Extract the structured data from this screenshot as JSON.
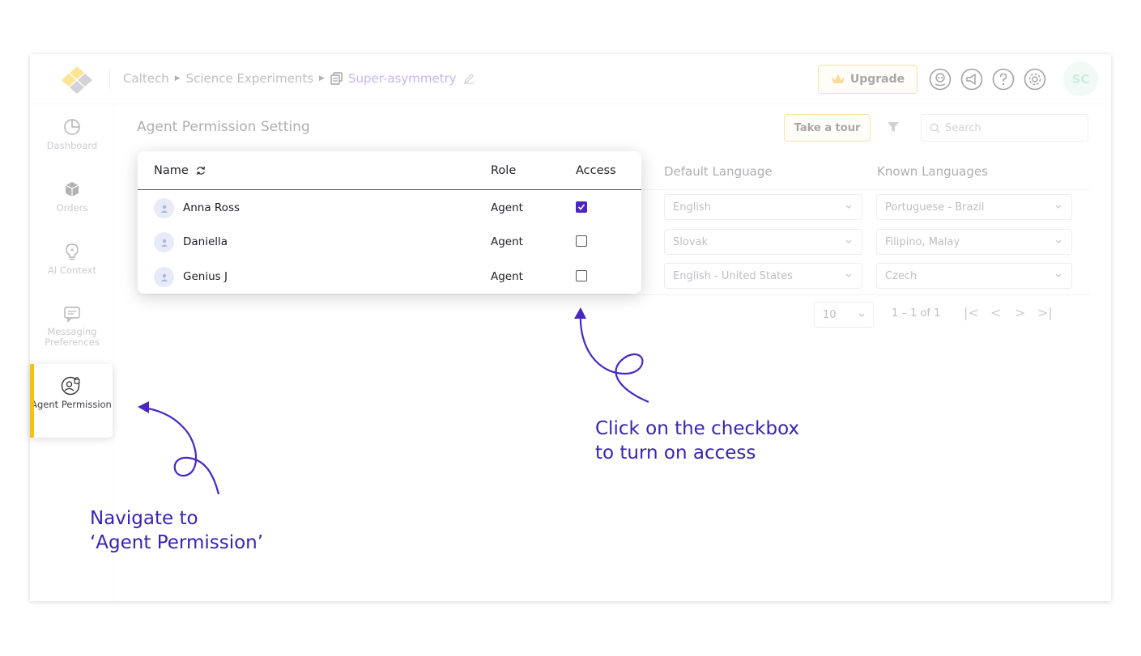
{
  "header": {
    "breadcrumb": [
      "Caltech",
      "Science Experiments",
      "Super-asymmetry"
    ],
    "upgrade_label": "Upgrade",
    "avatar_initials": "SC"
  },
  "sidebar": {
    "items": [
      {
        "label": "Dashboard",
        "icon": "pie-chart-icon"
      },
      {
        "label": "Orders",
        "icon": "box-icon"
      },
      {
        "label": "AI Context",
        "icon": "lightbulb-icon"
      },
      {
        "label": "Messaging Preferences",
        "icon": "message-icon"
      }
    ],
    "active": {
      "label": "Agent Permission",
      "icon": "user-lock-icon"
    }
  },
  "main": {
    "title": "Agent Permission Setting",
    "tour_label": "Take a tour",
    "search_placeholder": "Search",
    "columns": {
      "name": "Name",
      "role": "Role",
      "access": "Access",
      "default_language": "Default Language",
      "known_languages": "Known Languages"
    },
    "rows": [
      {
        "name": "Anna Ross",
        "role": "Agent",
        "access": true,
        "default_language": "English",
        "known_languages": "Portuguese - Brazil"
      },
      {
        "name": "Daniella",
        "role": "Agent",
        "access": false,
        "default_language": "Slovak",
        "known_languages": "Filipino, Malay"
      },
      {
        "name": "Genius J",
        "role": "Agent",
        "access": false,
        "default_language": "English - United States",
        "known_languages": "Czech"
      }
    ],
    "pagination": {
      "page_size": "10",
      "range": "1 – 1 of 1"
    }
  },
  "annotations": {
    "checkbox_line1": "Click on the checkbox",
    "checkbox_line2": "to turn on access",
    "nav_line1": "Navigate to",
    "nav_line2": "‘Agent Permission’"
  },
  "colors": {
    "accent_purple": "#4a27c4",
    "annotation": "#3b22b5",
    "active_bar": "#f5c211",
    "upgrade_border": "#f2c14b"
  }
}
